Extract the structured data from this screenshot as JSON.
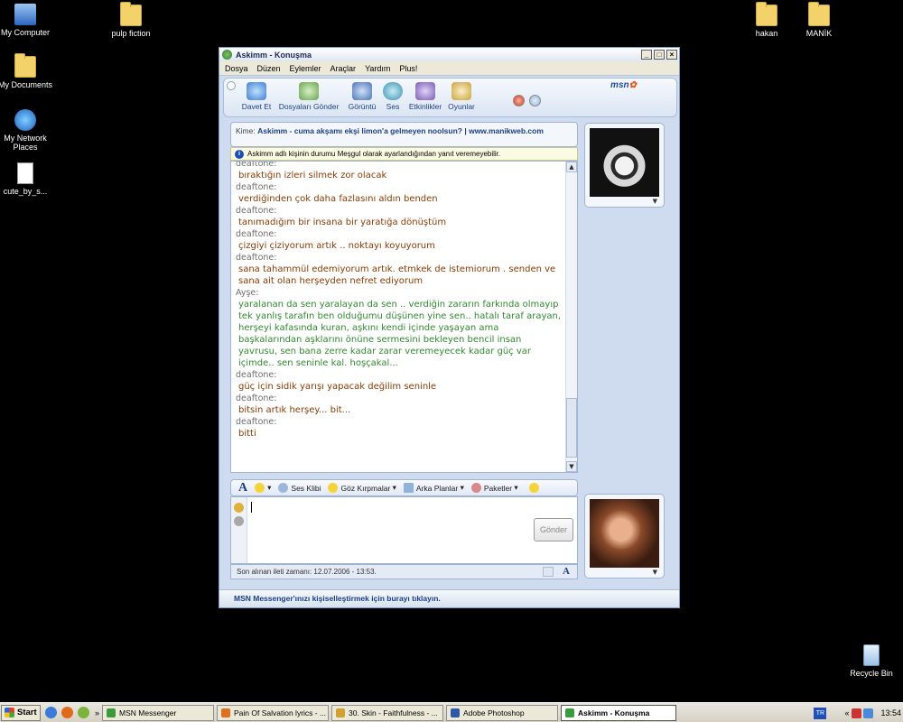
{
  "desktop": {
    "icons": [
      {
        "label": "My Computer"
      },
      {
        "label": "My Documents"
      },
      {
        "label": "My Network Places"
      },
      {
        "label": "cute_by_s..."
      },
      {
        "label": "pulp fiction"
      },
      {
        "label": "hakan"
      },
      {
        "label": "MANİK"
      },
      {
        "label": "Recycle Bin"
      }
    ]
  },
  "window": {
    "title": "Askimm - Konuşma",
    "controls": {
      "minimize": "_",
      "maximize": "□",
      "close": "×"
    },
    "menu": [
      "Dosya",
      "Düzen",
      "Eylemler",
      "Araçlar",
      "Yardım",
      "Plus!"
    ],
    "toolbar": [
      {
        "label": "Davet Et",
        "icon": "invite-icon",
        "color": "#3f7fd0"
      },
      {
        "label": "Dosyaları Gönder",
        "icon": "send-files-icon",
        "color": "#6aa34f"
      },
      {
        "label": "Görüntü",
        "icon": "video-icon",
        "color": "#4a73b8"
      },
      {
        "label": "Ses",
        "icon": "voice-icon",
        "color": "#3b8fb0"
      },
      {
        "label": "Etkinlikler",
        "icon": "activities-icon",
        "color": "#7a59b5"
      },
      {
        "label": "Oyunlar",
        "icon": "games-icon",
        "color": "#c9a23a"
      }
    ],
    "brand": "msn",
    "to_label": "Kime:",
    "to_value": "Askimm - cuma akşamı ekşi limon'a gelmeyen noolsun? | www.manikweb.com",
    "notice": "Askimm adlı kişinin durumu Meşgul olarak ayarlandığından yanıt veremeyebilir.",
    "conversation": [
      {
        "sender": "deaftone:",
        "text": "bıraktığın izleri silmek zor olacak",
        "style": "brown"
      },
      {
        "sender": "deaftone:",
        "text": "verdiğinden çok daha fazlasını aldın benden",
        "style": "brown"
      },
      {
        "sender": "deaftone:",
        "text": "tanımadığım bir insana bir yaratığa dönüştüm",
        "style": "brown"
      },
      {
        "sender": "deaftone:",
        "text": "çizgiyi çiziyorum artık .. noktayı koyuyorum",
        "style": "brown"
      },
      {
        "sender": "deaftone:",
        "text": "sana tahammül edemiyorum artık. etmkek de istemiorum . senden ve sana ait olan herşeyden nefret ediyorum",
        "style": "brown"
      },
      {
        "sender": "Ayşe:",
        "text": "yaralanan da sen yaralayan da sen .. verdiğin zararın farkında olmayıp tek yanlış tarafın ben olduğumu düşünen yine sen.. hatalı taraf arayan, herşeyi kafasında kuran, aşkını kendi içinde yaşayan ama başkalarından aşklarını önüne sermesini bekleyen bencil insan yavrusu, sen bana zerre kadar zarar veremeyecek kadar güç var içimde.. sen seninle kal. hoşçakal...",
        "style": "green"
      },
      {
        "sender": "deaftone:",
        "text": "güç için sidik yarışı yapacak değilim seninle",
        "style": "brown"
      },
      {
        "sender": "deaftone:",
        "text": "bitsin artık herşey... bit...",
        "style": "brown"
      },
      {
        "sender": "deaftone:",
        "text": "bitti",
        "style": "brown"
      }
    ],
    "format_bar": [
      "Ses Klibi",
      "Göz Kırpmalar",
      "Arka Planlar",
      "Paketler"
    ],
    "send_button": "Gönder",
    "status": "Son alınan ileti zamanı: 12.07.2006 - 13:53.",
    "bottom": "MSN Messenger'ınızı kişiselleştirmek için burayı tıklayın."
  },
  "taskbar": {
    "start": "Start",
    "tasks": [
      {
        "label": "MSN Messenger",
        "color": "#3b9a3b"
      },
      {
        "label": "Pain Of Salvation lyrics - ...",
        "color": "#e07020"
      },
      {
        "label": "30. Skin - Faithfulness - ...",
        "color": "#d0a030"
      },
      {
        "label": "Adobe Photoshop",
        "color": "#2a5aa8"
      },
      {
        "label": "Askimm - Konuşma",
        "color": "#3b9a3b",
        "active": true
      }
    ],
    "lang": "TR",
    "clock": "13:54"
  }
}
